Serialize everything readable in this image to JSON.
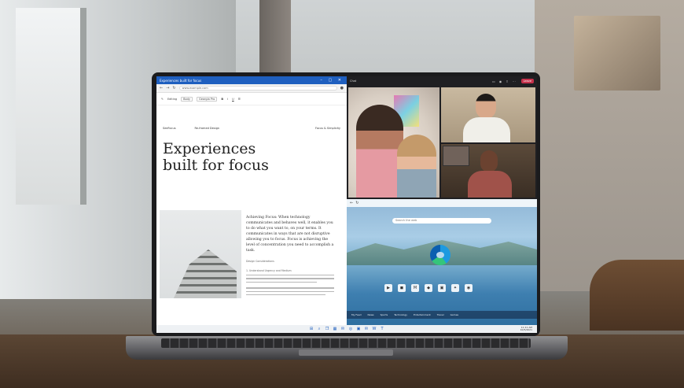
{
  "document_window": {
    "title": "Experiences built for focus",
    "address": "www.example.com",
    "ribbon": {
      "editing": "Editing",
      "style_box": "Body",
      "font_box": "Georgia Pro"
    },
    "page_header_left": "SeeFocus",
    "page_header_center": "Re-framed Design",
    "page_header_right": "Focus & Simplicity",
    "heading_line1": "Experiences",
    "heading_line2": "built for focus",
    "lead_paragraph": "Achieving Focus: When technology communicates and behaves well, it enables you to do what you want to, on your terms. It communicates in ways that are not disruptive allowing you to focus. Focus is achieving the level of concentration you need to accomplish a task.",
    "subheading": "Design Considerations",
    "subheading2": "1. Understand Urgency and Medium"
  },
  "call_window": {
    "title": "Chat",
    "leave_label": "Leave",
    "icons": [
      "video-icon",
      "mic-icon",
      "share-icon",
      "more-icon"
    ]
  },
  "browser_window": {
    "search_placeholder": "Search the web",
    "footer_tabs": [
      "My Feed",
      "News",
      "Sports",
      "Technology",
      "Entertainment",
      "Travel",
      "Games"
    ],
    "quick_links": [
      "▶",
      "◼",
      "M",
      "◆",
      "▣",
      "✦",
      "◉"
    ]
  },
  "taskbar": {
    "icons": [
      "windows-icon",
      "search-icon",
      "task-view-icon",
      "widgets-icon",
      "chat-icon",
      "edge-icon",
      "store-icon",
      "mail-icon",
      "word-icon",
      "teams-icon"
    ],
    "time": "11:11 AM",
    "date": "10/5/2021"
  },
  "colors": {
    "doc_accent": "#1f5fbf",
    "leave_button": "#c4314b"
  }
}
